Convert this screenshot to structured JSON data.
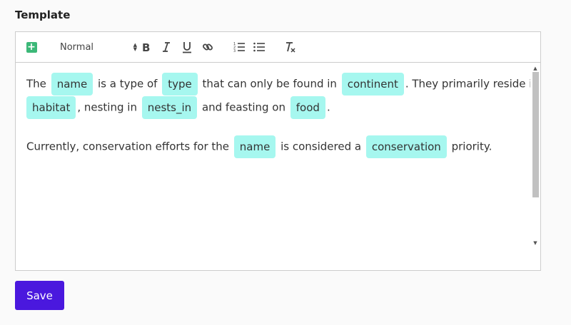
{
  "section": {
    "label": "Template"
  },
  "toolbar": {
    "insert_icon": "plus-square-icon",
    "format_value": "Normal",
    "icons": {
      "bold": "bold-icon",
      "italic": "italic-icon",
      "underline": "underline-icon",
      "link": "link-icon",
      "ordered_list": "ordered-list-icon",
      "bullet_list": "bullet-list-icon",
      "clear_format": "clear-format-icon"
    },
    "labels": {
      "bold": "B",
      "italic": "I",
      "underline": "U"
    }
  },
  "content": {
    "line1": {
      "t1": "The",
      "c1": "name",
      "t2": "is a type of",
      "c2": "type",
      "t3": "that can only be found in",
      "c3": "continent",
      "t4": ". They primarily reside in"
    },
    "line2": {
      "c1": "habitat",
      "t1": ", nesting in",
      "c2": "nests_in",
      "t2": "and feasting on",
      "c3": "food",
      "t3": "."
    },
    "line3": {
      "t1": "Currently, conservation efforts for the",
      "c1": "name",
      "t2": "is considered a",
      "c2": "conservation",
      "t3": "priority."
    }
  },
  "actions": {
    "save_label": "Save"
  },
  "colors": {
    "chip_bg": "#a6f7ef",
    "save_bg": "#4a18de",
    "insert_green": "#3cb878"
  }
}
